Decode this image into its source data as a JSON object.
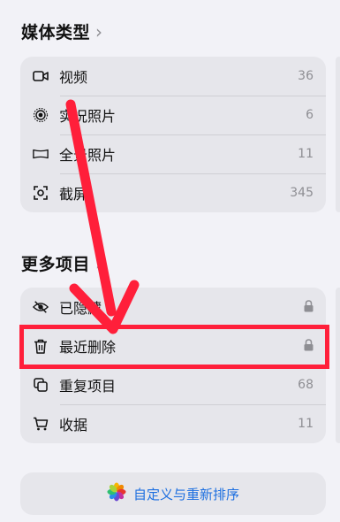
{
  "media_types": {
    "title": "媒体类型",
    "items": [
      {
        "label": "视频",
        "count": "36",
        "icon": "video-icon"
      },
      {
        "label": "实况照片",
        "count": "6",
        "icon": "live-photo-icon"
      },
      {
        "label": "全景照片",
        "count": "11",
        "icon": "panorama-icon"
      },
      {
        "label": "截屏",
        "count": "345",
        "icon": "screenshot-icon"
      }
    ]
  },
  "more_items": {
    "title": "更多项目",
    "items": [
      {
        "label": "已隐藏",
        "icon": "hidden-eye-icon",
        "locked": true
      },
      {
        "label": "最近删除",
        "icon": "trash-icon",
        "locked": true
      },
      {
        "label": "重复项目",
        "count": "68",
        "icon": "duplicate-icon"
      },
      {
        "label": "收据",
        "count": "11",
        "icon": "cart-icon"
      }
    ]
  },
  "customize": {
    "label": "自定义与重新排序",
    "icon": "photos-flower-icon"
  },
  "annotation": {
    "arrow_color": "#ff1f3a",
    "box_color": "#ff1f3a"
  }
}
